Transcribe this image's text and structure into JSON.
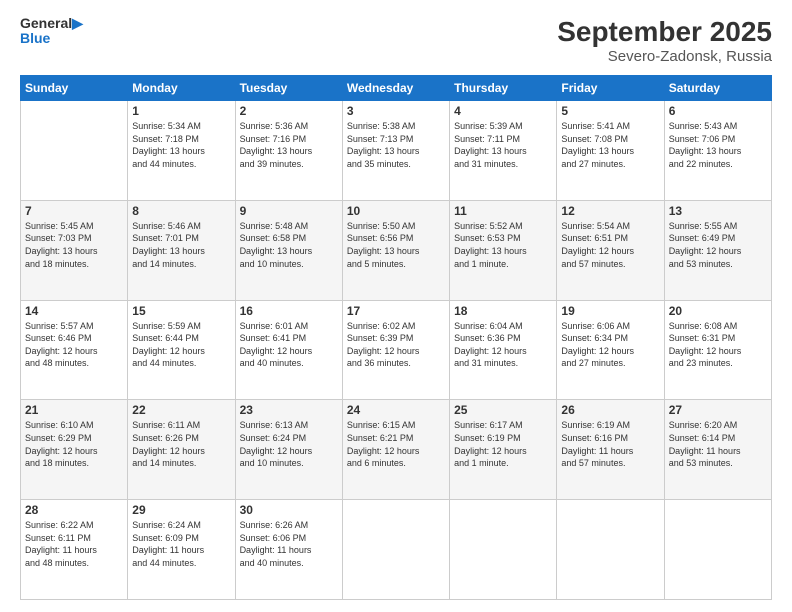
{
  "header": {
    "logo": {
      "line1": "General",
      "line2": "Blue"
    },
    "title": "September 2025",
    "location": "Severo-Zadonsk, Russia"
  },
  "weekdays": [
    "Sunday",
    "Monday",
    "Tuesday",
    "Wednesday",
    "Thursday",
    "Friday",
    "Saturday"
  ],
  "weeks": [
    [
      {
        "day": "",
        "info": ""
      },
      {
        "day": "1",
        "info": "Sunrise: 5:34 AM\nSunset: 7:18 PM\nDaylight: 13 hours\nand 44 minutes."
      },
      {
        "day": "2",
        "info": "Sunrise: 5:36 AM\nSunset: 7:16 PM\nDaylight: 13 hours\nand 39 minutes."
      },
      {
        "day": "3",
        "info": "Sunrise: 5:38 AM\nSunset: 7:13 PM\nDaylight: 13 hours\nand 35 minutes."
      },
      {
        "day": "4",
        "info": "Sunrise: 5:39 AM\nSunset: 7:11 PM\nDaylight: 13 hours\nand 31 minutes."
      },
      {
        "day": "5",
        "info": "Sunrise: 5:41 AM\nSunset: 7:08 PM\nDaylight: 13 hours\nand 27 minutes."
      },
      {
        "day": "6",
        "info": "Sunrise: 5:43 AM\nSunset: 7:06 PM\nDaylight: 13 hours\nand 22 minutes."
      }
    ],
    [
      {
        "day": "7",
        "info": "Sunrise: 5:45 AM\nSunset: 7:03 PM\nDaylight: 13 hours\nand 18 minutes."
      },
      {
        "day": "8",
        "info": "Sunrise: 5:46 AM\nSunset: 7:01 PM\nDaylight: 13 hours\nand 14 minutes."
      },
      {
        "day": "9",
        "info": "Sunrise: 5:48 AM\nSunset: 6:58 PM\nDaylight: 13 hours\nand 10 minutes."
      },
      {
        "day": "10",
        "info": "Sunrise: 5:50 AM\nSunset: 6:56 PM\nDaylight: 13 hours\nand 5 minutes."
      },
      {
        "day": "11",
        "info": "Sunrise: 5:52 AM\nSunset: 6:53 PM\nDaylight: 13 hours\nand 1 minute."
      },
      {
        "day": "12",
        "info": "Sunrise: 5:54 AM\nSunset: 6:51 PM\nDaylight: 12 hours\nand 57 minutes."
      },
      {
        "day": "13",
        "info": "Sunrise: 5:55 AM\nSunset: 6:49 PM\nDaylight: 12 hours\nand 53 minutes."
      }
    ],
    [
      {
        "day": "14",
        "info": "Sunrise: 5:57 AM\nSunset: 6:46 PM\nDaylight: 12 hours\nand 48 minutes."
      },
      {
        "day": "15",
        "info": "Sunrise: 5:59 AM\nSunset: 6:44 PM\nDaylight: 12 hours\nand 44 minutes."
      },
      {
        "day": "16",
        "info": "Sunrise: 6:01 AM\nSunset: 6:41 PM\nDaylight: 12 hours\nand 40 minutes."
      },
      {
        "day": "17",
        "info": "Sunrise: 6:02 AM\nSunset: 6:39 PM\nDaylight: 12 hours\nand 36 minutes."
      },
      {
        "day": "18",
        "info": "Sunrise: 6:04 AM\nSunset: 6:36 PM\nDaylight: 12 hours\nand 31 minutes."
      },
      {
        "day": "19",
        "info": "Sunrise: 6:06 AM\nSunset: 6:34 PM\nDaylight: 12 hours\nand 27 minutes."
      },
      {
        "day": "20",
        "info": "Sunrise: 6:08 AM\nSunset: 6:31 PM\nDaylight: 12 hours\nand 23 minutes."
      }
    ],
    [
      {
        "day": "21",
        "info": "Sunrise: 6:10 AM\nSunset: 6:29 PM\nDaylight: 12 hours\nand 18 minutes."
      },
      {
        "day": "22",
        "info": "Sunrise: 6:11 AM\nSunset: 6:26 PM\nDaylight: 12 hours\nand 14 minutes."
      },
      {
        "day": "23",
        "info": "Sunrise: 6:13 AM\nSunset: 6:24 PM\nDaylight: 12 hours\nand 10 minutes."
      },
      {
        "day": "24",
        "info": "Sunrise: 6:15 AM\nSunset: 6:21 PM\nDaylight: 12 hours\nand 6 minutes."
      },
      {
        "day": "25",
        "info": "Sunrise: 6:17 AM\nSunset: 6:19 PM\nDaylight: 12 hours\nand 1 minute."
      },
      {
        "day": "26",
        "info": "Sunrise: 6:19 AM\nSunset: 6:16 PM\nDaylight: 11 hours\nand 57 minutes."
      },
      {
        "day": "27",
        "info": "Sunrise: 6:20 AM\nSunset: 6:14 PM\nDaylight: 11 hours\nand 53 minutes."
      }
    ],
    [
      {
        "day": "28",
        "info": "Sunrise: 6:22 AM\nSunset: 6:11 PM\nDaylight: 11 hours\nand 48 minutes."
      },
      {
        "day": "29",
        "info": "Sunrise: 6:24 AM\nSunset: 6:09 PM\nDaylight: 11 hours\nand 44 minutes."
      },
      {
        "day": "30",
        "info": "Sunrise: 6:26 AM\nSunset: 6:06 PM\nDaylight: 11 hours\nand 40 minutes."
      },
      {
        "day": "",
        "info": ""
      },
      {
        "day": "",
        "info": ""
      },
      {
        "day": "",
        "info": ""
      },
      {
        "day": "",
        "info": ""
      }
    ]
  ]
}
